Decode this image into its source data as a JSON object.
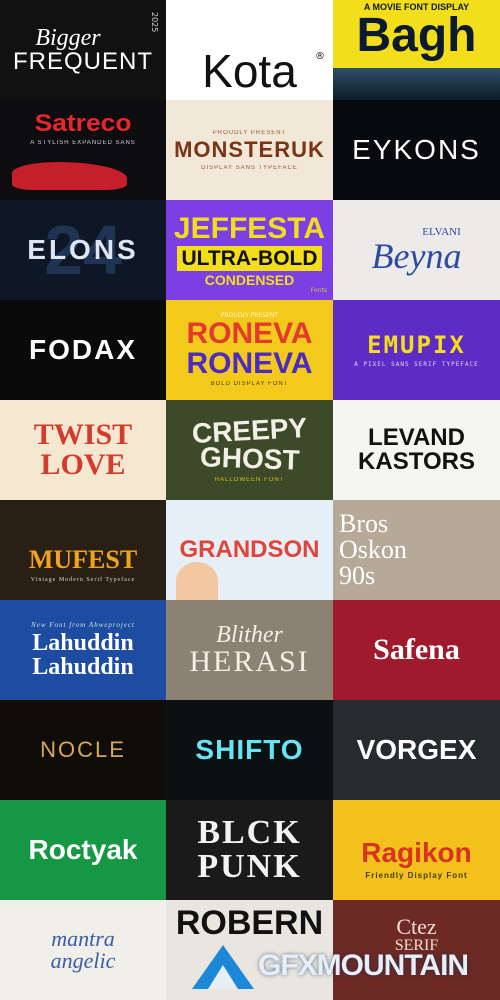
{
  "tiles": [
    {
      "lines": [
        "Bigger",
        "FREQUENT"
      ],
      "extra": "2025"
    },
    {
      "lines": [
        "Kota"
      ],
      "extra": "®"
    },
    {
      "lines": [
        "A MOVIE FONT DISPLAY",
        "Bagh"
      ]
    },
    {
      "lines": [
        "Satreco",
        "A STYLISH EXPANDED SANS"
      ]
    },
    {
      "lines": [
        "PROUDLY PRESENT",
        "MONSTERUK",
        "DISPLAY SANS TYPEFACE"
      ]
    },
    {
      "lines": [
        "EYKONS"
      ]
    },
    {
      "lines": [
        "ELONS"
      ],
      "extra": "24"
    },
    {
      "lines": [
        "JEFFESTA",
        "ULTRA-BOLD",
        "CONDENSED"
      ],
      "extra": "Fonts"
    },
    {
      "lines": [
        "ELVANI",
        "Beyna"
      ]
    },
    {
      "lines": [
        "FODAX"
      ]
    },
    {
      "lines": [
        "RONEVA",
        "RONEVA",
        "BOLD DISPLAY FONT"
      ],
      "extra": "PROUDLY PRESENT"
    },
    {
      "lines": [
        "EMUPIX",
        "A PIXEL SANS SERIF TYPEFACE"
      ]
    },
    {
      "lines": [
        "TWIST",
        "LOVE"
      ]
    },
    {
      "lines": [
        "CREEPY",
        "GHOST",
        "HALLOWEEN FONT"
      ]
    },
    {
      "lines": [
        "LEVAND",
        "KASTORS"
      ]
    },
    {
      "lines": [
        "MUFEST",
        "Vintage Modern Serif Typeface"
      ]
    },
    {
      "lines": [
        "GRANDSON"
      ]
    },
    {
      "lines": [
        "Bros",
        "Oskon",
        "90s"
      ]
    },
    {
      "lines": [
        "New Font from Abweproject",
        "Lahuddin",
        "Lahuddin"
      ]
    },
    {
      "lines": [
        "Blither",
        "HERASI"
      ]
    },
    {
      "lines": [
        "Safena"
      ]
    },
    {
      "lines": [
        "NOCLE"
      ]
    },
    {
      "lines": [
        "SHIFTO"
      ]
    },
    {
      "lines": [
        "VORGEX"
      ]
    },
    {
      "lines": [
        "Roctyak"
      ]
    },
    {
      "lines": [
        "BLCK",
        "PUNK"
      ]
    },
    {
      "lines": [
        "Ragikon",
        "Friendly Display Font"
      ]
    },
    {
      "lines": [
        "mantra",
        "angelic"
      ]
    },
    {
      "lines": [
        "ROBERN"
      ]
    },
    {
      "lines": [
        "Ctez",
        "SERIF"
      ]
    }
  ],
  "watermark": {
    "text": "GFXMOUNTAIN"
  },
  "colors": {
    "accent_yellow": "#f3de1b",
    "accent_purple": "#7b3fe4",
    "accent_red": "#c41f2a",
    "watermark_blue": "#1e88d8"
  }
}
